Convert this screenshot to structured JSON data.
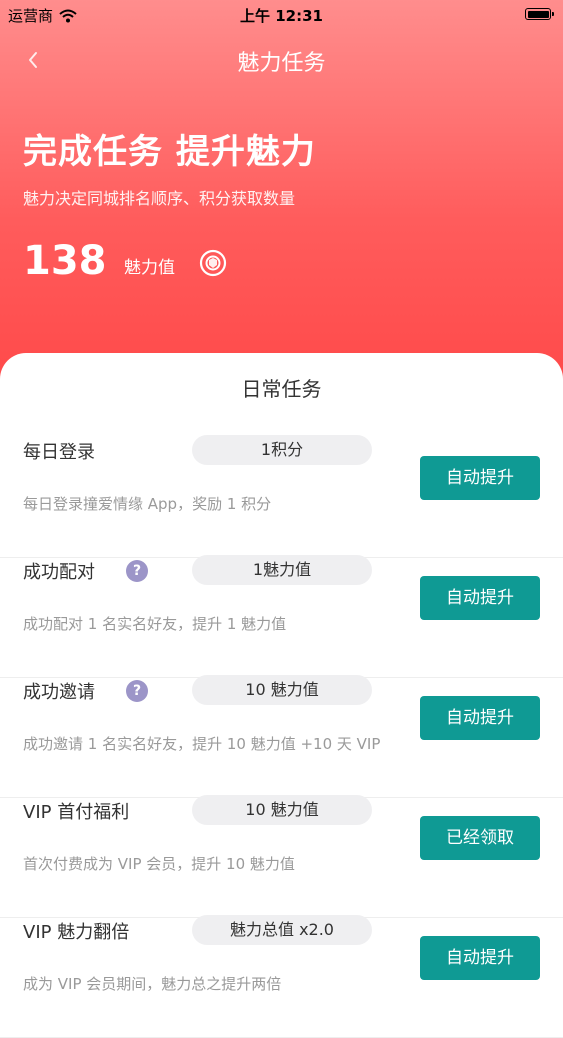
{
  "status_bar": {
    "carrier": "运营商",
    "time": "上午 12:31"
  },
  "nav": {
    "title": "魅力任务",
    "back_icon": "chevron-left-icon"
  },
  "hero": {
    "title": "完成任务 提升魅力",
    "subtitle": "魅力决定同城排名顺序、积分获取数量",
    "score_value": "138",
    "score_label": "魅力值"
  },
  "section_title": "日常任务",
  "tasks": [
    {
      "name": "每日登录",
      "help": false,
      "reward": "1积分",
      "desc": "每日登录撞爱情缘 App，奖励 1 积分",
      "action": "自动提升"
    },
    {
      "name": "成功配对",
      "help": true,
      "reward": "1魅力值",
      "desc": "成功配对 1 名实名好友，提升 1 魅力值",
      "action": "自动提升"
    },
    {
      "name": "成功邀请",
      "help": true,
      "reward": "10 魅力值",
      "desc": "成功邀请 1 名实名好友，提升 10 魅力值 +10 天 VIP",
      "action": "自动提升"
    },
    {
      "name": "VIP 首付福利",
      "help": false,
      "reward": "10 魅力值",
      "desc": "首次付费成为 VIP 会员，提升 10 魅力值",
      "action": "已经领取"
    },
    {
      "name": "VIP 魅力翻倍",
      "help": false,
      "reward": "魅力总值 x2.0",
      "desc": "成为 VIP 会员期间，魅力总之提升两倍",
      "action": "自动提升"
    }
  ],
  "help_glyph": "?",
  "colors": {
    "accent_red": "#ff5c5c",
    "action_teal": "#0f9a94",
    "help_purple": "#9c95c8"
  }
}
